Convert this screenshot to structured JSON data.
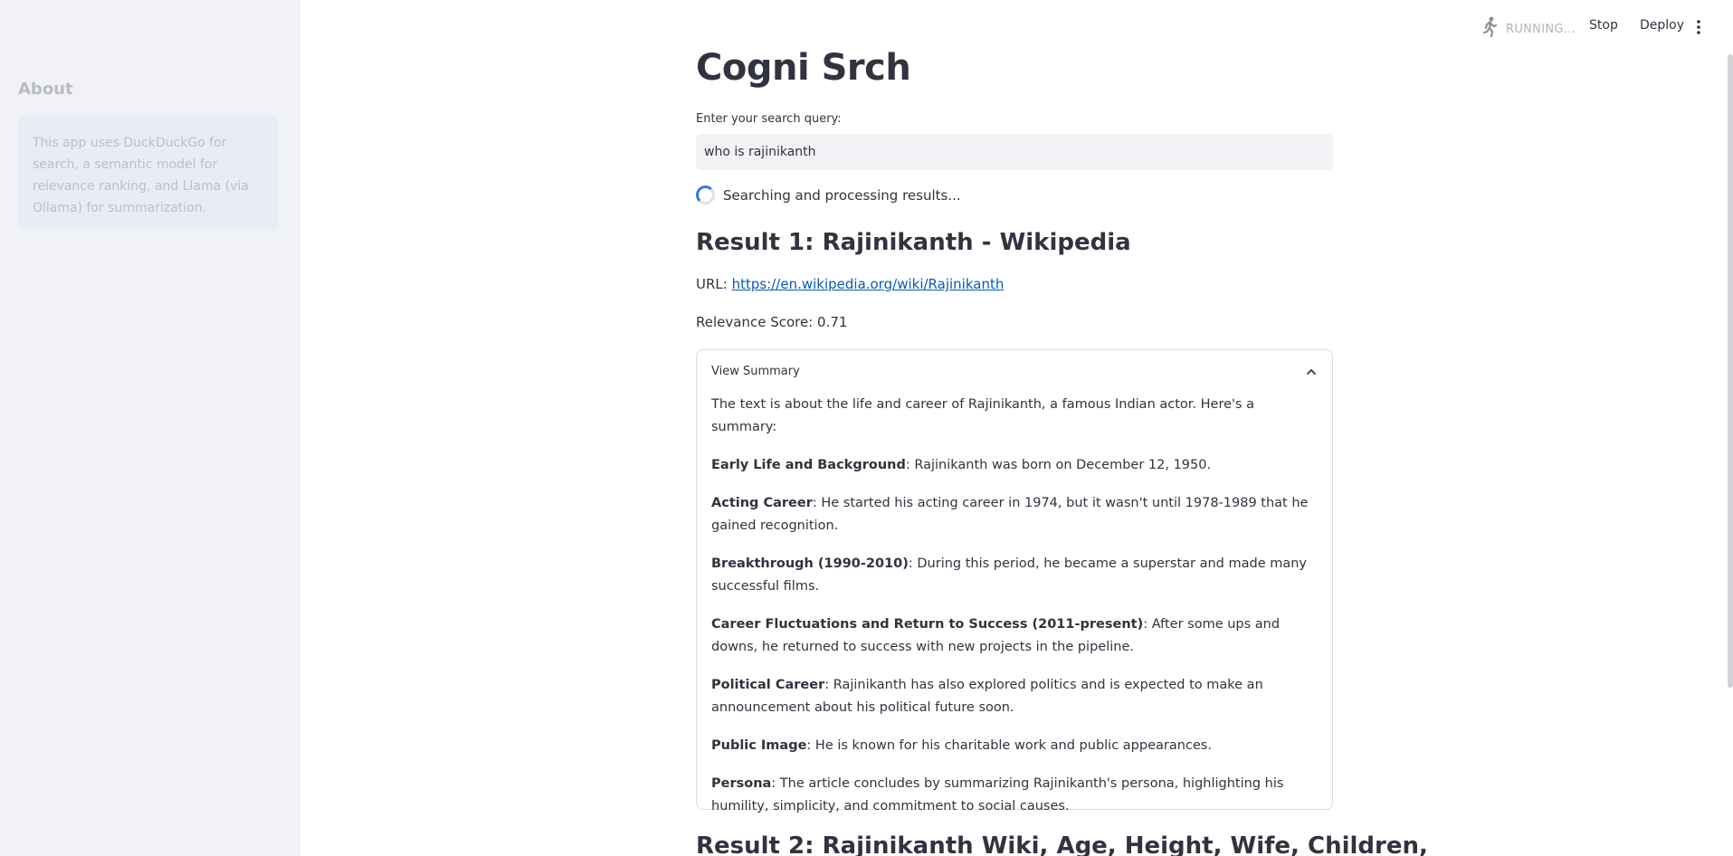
{
  "sidebar": {
    "title": "About",
    "info": "This app uses DuckDuckGo for search, a semantic model for relevance ranking, and Llama (via Ollama) for summarization."
  },
  "header": {
    "status": "RUNNING...",
    "stop_label": "Stop",
    "deploy_label": "Deploy",
    "icons": {
      "status": "running-man-icon",
      "menu": "kebab-menu-icon"
    }
  },
  "main": {
    "title": "Cogni Srch",
    "query_label": "Enter your search query:",
    "query_value": "who is rajinikanth",
    "spinner_text": "Searching and processing results...",
    "results": [
      {
        "title": "Result 1: Rajinikanth - Wikipedia",
        "url_prefix": "URL: ",
        "url": "https://en.wikipedia.org/wiki/Rajinikanth",
        "score_text": "Relevance Score: 0.71",
        "expander_label": "View Summary",
        "summary_intro": "The text is about the life and career of Rajinikanth, a famous Indian actor. Here's a summary:",
        "summary_items": [
          {
            "head": "Early Life and Background",
            "text": ": Rajinikanth was born on December 12, 1950."
          },
          {
            "head": "Acting Career",
            "text": ": He started his acting career in 1974, but it wasn't until 1978-1989 that he gained recognition."
          },
          {
            "head": "Breakthrough (1990-2010)",
            "text": ": During this period, he became a superstar and made many successful films."
          },
          {
            "head": "Career Fluctuations and Return to Success (2011-present)",
            "text": ": After some ups and downs, he returned to success with new projects in the pipeline."
          },
          {
            "head": "Political Career",
            "text": ": Rajinikanth has also explored politics and is expected to make an announcement about his political future soon."
          },
          {
            "head": "Public Image",
            "text": ": He is known for his charitable work and public appearances."
          },
          {
            "head": "Persona",
            "text": ": The article concludes by summarizing Rajinikanth's persona, highlighting his humility, simplicity, and commitment to social causes."
          }
        ]
      },
      {
        "title": "Result 2: Rajinikanth Wiki, Age, Height, Wife, Children,"
      }
    ]
  }
}
